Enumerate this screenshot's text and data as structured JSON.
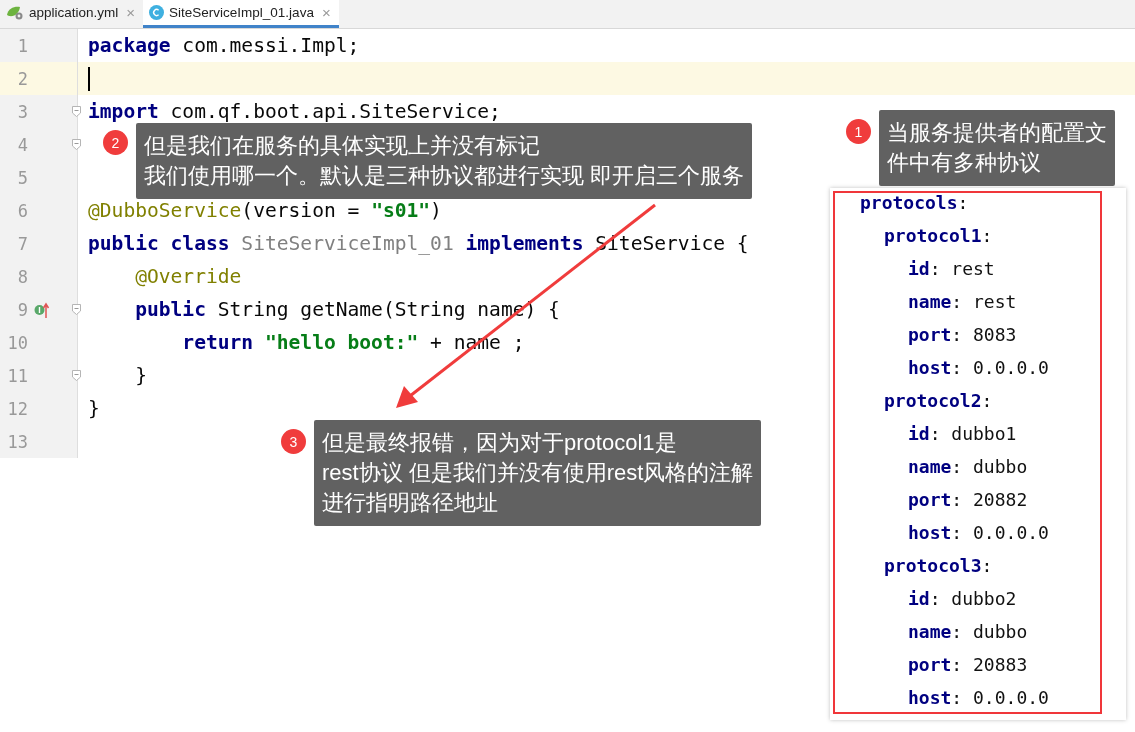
{
  "tabs": [
    {
      "label": "application.yml",
      "close": "×",
      "selected": false
    },
    {
      "label": "SiteServiceImpl_01.java",
      "close": "×",
      "selected": true
    }
  ],
  "editor": {
    "lines": [
      {
        "number": "1",
        "current": false,
        "fold": false,
        "override_marker": false,
        "tokens": [
          {
            "kind": "keyword",
            "text": "package"
          },
          {
            "kind": "plain",
            "text": " com.messi.Impl;"
          }
        ]
      },
      {
        "number": "2",
        "current": true,
        "fold": false,
        "override_marker": false
      },
      {
        "number": "3",
        "current": false,
        "fold": true,
        "override_marker": false,
        "tokens": [
          {
            "kind": "keyword",
            "text": "import"
          },
          {
            "kind": "plain",
            "text": " com.qf.boot.api.SiteService;"
          }
        ]
      },
      {
        "number": "4",
        "current": false,
        "fold": true,
        "override_marker": false
      },
      {
        "number": "5",
        "current": false,
        "fold": false,
        "override_marker": false
      },
      {
        "number": "6",
        "current": false,
        "fold": false,
        "override_marker": false,
        "tokens": [
          {
            "kind": "annotation",
            "text": "@DubboService"
          },
          {
            "kind": "plain",
            "text": "(version = "
          },
          {
            "kind": "string",
            "text": "\"s01\""
          },
          {
            "kind": "plain",
            "text": ")"
          }
        ]
      },
      {
        "number": "7",
        "current": false,
        "fold": false,
        "override_marker": false,
        "tokens": [
          {
            "kind": "keyword",
            "text": "public class "
          },
          {
            "kind": "unused",
            "text": "SiteServiceImpl_01 "
          },
          {
            "kind": "keyword",
            "text": "implements "
          },
          {
            "kind": "plain",
            "text": "SiteService {"
          }
        ]
      },
      {
        "number": "8",
        "current": false,
        "fold": false,
        "override_marker": false,
        "tokens": [
          {
            "kind": "annotation",
            "text": "    @Override"
          }
        ]
      },
      {
        "number": "9",
        "current": false,
        "fold": true,
        "override_marker": true,
        "tokens": [
          {
            "kind": "keyword",
            "text": "    public"
          },
          {
            "kind": "plain",
            "text": " String getName(String name) {"
          }
        ]
      },
      {
        "number": "10",
        "current": false,
        "fold": false,
        "override_marker": false,
        "tokens": [
          {
            "kind": "keyword",
            "text": "        return "
          },
          {
            "kind": "string",
            "text": "\"hello boot:\""
          },
          {
            "kind": "plain",
            "text": " + name ;"
          }
        ]
      },
      {
        "number": "11",
        "current": false,
        "fold": true,
        "override_marker": false,
        "tokens": [
          {
            "kind": "plain",
            "text": "    }"
          }
        ]
      },
      {
        "number": "12",
        "current": false,
        "fold": false,
        "override_marker": false,
        "tokens": [
          {
            "kind": "plain",
            "text": "}"
          }
        ]
      },
      {
        "number": "13",
        "current": false,
        "fold": false,
        "override_marker": false
      }
    ]
  },
  "yaml_panel": {
    "items": [
      {
        "text": "**protocols**:",
        "children": [
          {
            "text": "**protocol1**:",
            "children": [
              {
                "text": "**id**: rest"
              },
              {
                "text": "**name**: rest"
              },
              {
                "text": "**port**: 8083"
              },
              {
                "text": "**host**: 0.0.0.0"
              }
            ]
          },
          {
            "text": "**protocol2**:",
            "children": [
              {
                "text": "**id**: dubbo1"
              },
              {
                "text": "**name**: dubbo"
              },
              {
                "text": "**port**: 20882"
              },
              {
                "text": "**host**: 0.0.0.0"
              }
            ]
          },
          {
            "text": "**protocol3**:",
            "children": [
              {
                "text": "**id**: dubbo2"
              },
              {
                "text": "**name**: dubbo"
              },
              {
                "text": "**port**: 20883"
              },
              {
                "text": "**host**: 0.0.0.0"
              }
            ]
          }
        ]
      }
    ]
  },
  "callouts": [
    {
      "number": "2",
      "lines": [
        "但是我们在服务的具体实现上并没有标记",
        "我们使用哪一个。默认是三种协议都进行实现 即开启三个服务"
      ]
    },
    {
      "number": "1",
      "lines": [
        "当服务提供者的配置文",
        "件中有多种协议"
      ]
    },
    {
      "number": "3",
      "lines": [
        "但是最终报错，因为对于protocol1是",
        "rest协议 但是我们并没有使用rest风格的注解",
        "进行指明路径地址"
      ]
    }
  ]
}
